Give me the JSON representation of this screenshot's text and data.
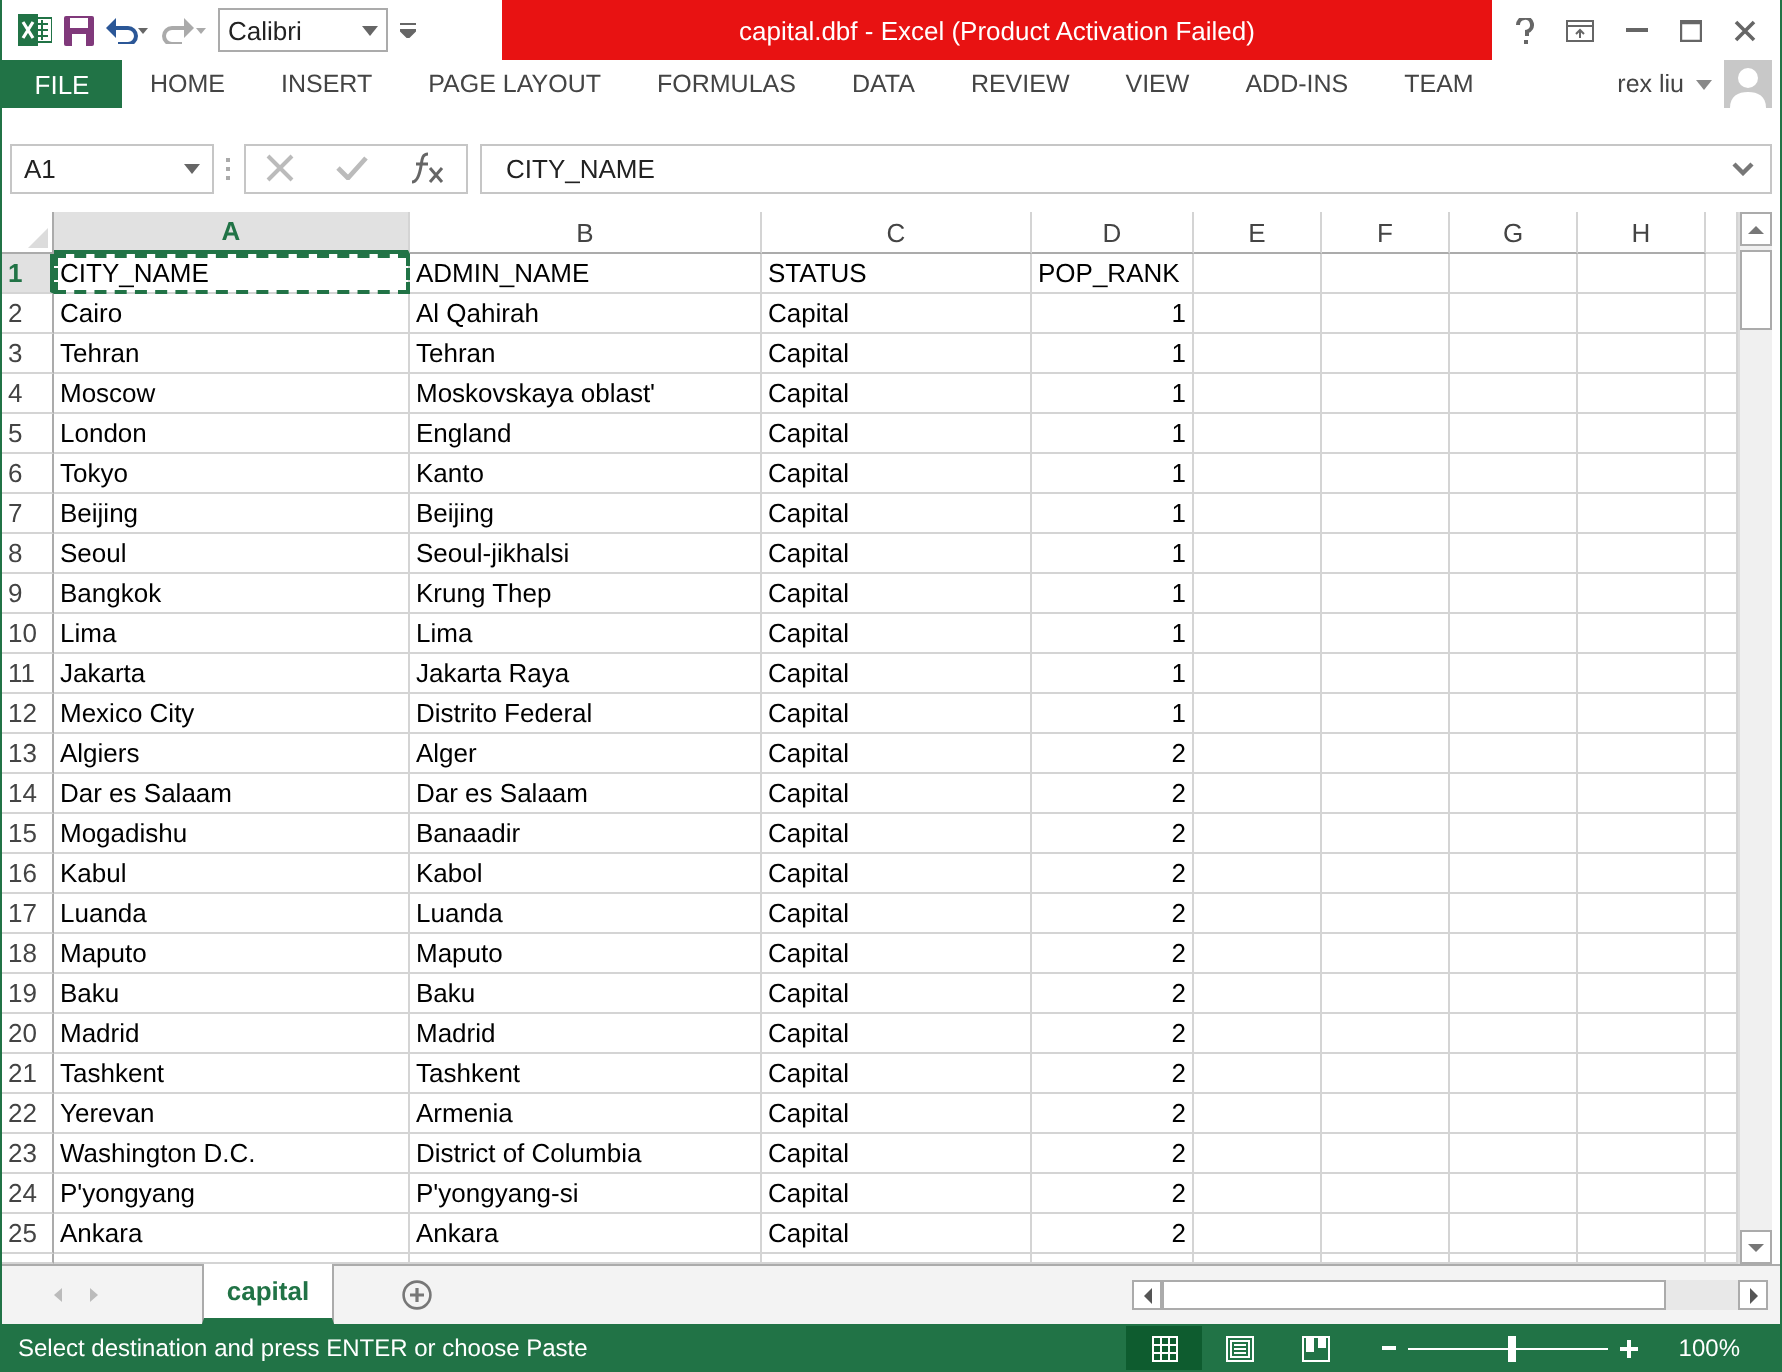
{
  "window": {
    "title": "capital.dbf -  Excel (Product Activation Failed)"
  },
  "quick_access": {
    "font": "Calibri"
  },
  "file_tab": "FILE",
  "ribbon_tabs": [
    {
      "label": "HOME",
      "selected": false
    },
    {
      "label": "INSERT",
      "selected": false
    },
    {
      "label": "PAGE LAYOUT",
      "selected": false
    },
    {
      "label": "FORMULAS",
      "selected": false
    },
    {
      "label": "DATA",
      "selected": false
    },
    {
      "label": "REVIEW",
      "selected": false
    },
    {
      "label": "VIEW",
      "selected": false
    },
    {
      "label": "ADD-INS",
      "selected": false
    },
    {
      "label": "TEAM",
      "selected": false
    }
  ],
  "user": {
    "name": "rex liu"
  },
  "formula_bar": {
    "name_box": "A1",
    "formula": "CITY_NAME"
  },
  "columns": [
    {
      "label": "A",
      "selected": true
    },
    {
      "label": "B",
      "selected": false
    },
    {
      "label": "C",
      "selected": false
    },
    {
      "label": "D",
      "selected": false
    },
    {
      "label": "E",
      "selected": false
    },
    {
      "label": "F",
      "selected": false
    },
    {
      "label": "G",
      "selected": false
    },
    {
      "label": "H",
      "selected": false
    }
  ],
  "rows": [
    {
      "number": "1",
      "selected": true,
      "cells": [
        "CITY_NAME",
        "ADMIN_NAME",
        "STATUS",
        "POP_RANK"
      ]
    },
    {
      "number": "2",
      "selected": false,
      "cells": [
        "Cairo",
        "Al Qahirah",
        "Capital",
        "1"
      ]
    },
    {
      "number": "3",
      "selected": false,
      "cells": [
        "Tehran",
        "Tehran",
        "Capital",
        "1"
      ]
    },
    {
      "number": "4",
      "selected": false,
      "cells": [
        "Moscow",
        "Moskovskaya oblast'",
        "Capital",
        "1"
      ]
    },
    {
      "number": "5",
      "selected": false,
      "cells": [
        "London",
        "England",
        "Capital",
        "1"
      ]
    },
    {
      "number": "6",
      "selected": false,
      "cells": [
        "Tokyo",
        "Kanto",
        "Capital",
        "1"
      ]
    },
    {
      "number": "7",
      "selected": false,
      "cells": [
        "Beijing",
        "Beijing",
        "Capital",
        "1"
      ]
    },
    {
      "number": "8",
      "selected": false,
      "cells": [
        "Seoul",
        "Seoul-jikhalsi",
        "Capital",
        "1"
      ]
    },
    {
      "number": "9",
      "selected": false,
      "cells": [
        "Bangkok",
        "Krung Thep",
        "Capital",
        "1"
      ]
    },
    {
      "number": "10",
      "selected": false,
      "cells": [
        "Lima",
        "Lima",
        "Capital",
        "1"
      ]
    },
    {
      "number": "11",
      "selected": false,
      "cells": [
        "Jakarta",
        "Jakarta Raya",
        "Capital",
        "1"
      ]
    },
    {
      "number": "12",
      "selected": false,
      "cells": [
        "Mexico City",
        "Distrito Federal",
        "Capital",
        "1"
      ]
    },
    {
      "number": "13",
      "selected": false,
      "cells": [
        "Algiers",
        "Alger",
        "Capital",
        "2"
      ]
    },
    {
      "number": "14",
      "selected": false,
      "cells": [
        "Dar es Salaam",
        "Dar es Salaam",
        "Capital",
        "2"
      ]
    },
    {
      "number": "15",
      "selected": false,
      "cells": [
        "Mogadishu",
        "Banaadir",
        "Capital",
        "2"
      ]
    },
    {
      "number": "16",
      "selected": false,
      "cells": [
        "Kabul",
        "Kabol",
        "Capital",
        "2"
      ]
    },
    {
      "number": "17",
      "selected": false,
      "cells": [
        "Luanda",
        "Luanda",
        "Capital",
        "2"
      ]
    },
    {
      "number": "18",
      "selected": false,
      "cells": [
        "Maputo",
        "Maputo",
        "Capital",
        "2"
      ]
    },
    {
      "number": "19",
      "selected": false,
      "cells": [
        "Baku",
        "Baku",
        "Capital",
        "2"
      ]
    },
    {
      "number": "20",
      "selected": false,
      "cells": [
        "Madrid",
        "Madrid",
        "Capital",
        "2"
      ]
    },
    {
      "number": "21",
      "selected": false,
      "cells": [
        "Tashkent",
        "Tashkent",
        "Capital",
        "2"
      ]
    },
    {
      "number": "22",
      "selected": false,
      "cells": [
        "Yerevan",
        "Armenia",
        "Capital",
        "2"
      ]
    },
    {
      "number": "23",
      "selected": false,
      "cells": [
        "Washington D.C.",
        "District of Columbia",
        "Capital",
        "2"
      ]
    },
    {
      "number": "24",
      "selected": false,
      "cells": [
        "P'yongyang",
        "P'yongyang-si",
        "Capital",
        "2"
      ]
    },
    {
      "number": "25",
      "selected": false,
      "cells": [
        "Ankara",
        "Ankara",
        "Capital",
        "2"
      ]
    }
  ],
  "sheet_tabs": [
    {
      "label": "capital",
      "selected": true
    }
  ],
  "status_bar": {
    "message": "Select destination and press ENTER or choose Paste",
    "views": [
      {
        "kind": "normal",
        "selected": true
      },
      {
        "kind": "page_layout",
        "selected": false
      },
      {
        "kind": "page_break",
        "selected": false
      }
    ],
    "zoom": {
      "level": 0.52,
      "reading": "100%"
    }
  }
}
